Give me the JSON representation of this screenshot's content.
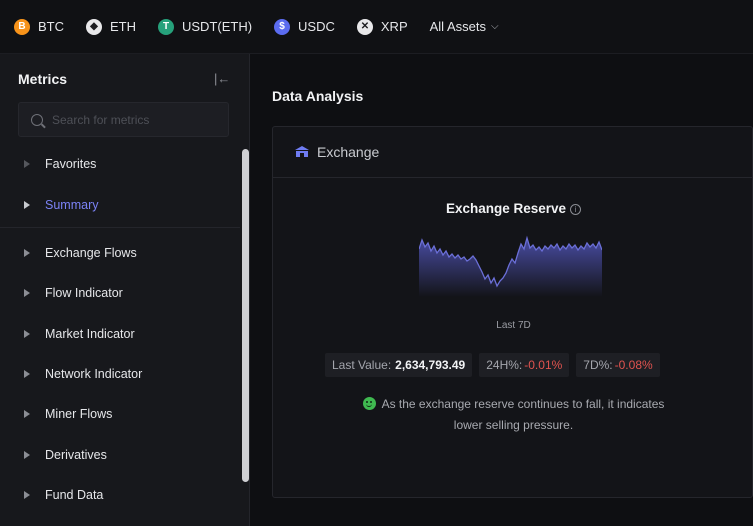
{
  "assets": [
    {
      "label": "BTC",
      "icon": "bitcoin-icon",
      "glyph": "B"
    },
    {
      "label": "ETH",
      "icon": "ethereum-icon",
      "glyph": "◆"
    },
    {
      "label": "USDT(ETH)",
      "icon": "tether-icon",
      "glyph": "T"
    },
    {
      "label": "USDC",
      "icon": "usdc-icon",
      "glyph": "$"
    },
    {
      "label": "XRP",
      "icon": "xrp-icon",
      "glyph": "✕"
    },
    {
      "label": "All Assets",
      "icon": "chevron-down-icon"
    }
  ],
  "sidebar": {
    "title": "Metrics",
    "search_placeholder": "Search for metrics",
    "items": [
      {
        "label": "Favorites"
      },
      {
        "label": "Summary",
        "active": true
      },
      {
        "label": "Exchange Flows"
      },
      {
        "label": "Flow Indicator"
      },
      {
        "label": "Market Indicator"
      },
      {
        "label": "Network Indicator"
      },
      {
        "label": "Miner Flows"
      },
      {
        "label": "Derivatives"
      },
      {
        "label": "Fund Data"
      }
    ]
  },
  "main": {
    "section_title": "Data Analysis",
    "card": {
      "title": "Exchange",
      "metric_title": "Exchange Reserve",
      "period": "Last 7D",
      "last_value_label": "Last Value:",
      "last_value": "2,634,793.49",
      "change_24h_label": "24H%:",
      "change_24h": "-0.01%",
      "change_7d_label": "7D%:",
      "change_7d": "-0.08%",
      "note_line1": "As the exchange reserve continues to fall, it indicates",
      "note_line2": "lower selling pressure."
    }
  },
  "colors": {
    "accent": "#7b82f5",
    "negative": "#e0534f",
    "positive": "#3fb950",
    "sparkline": "#6b6fd8"
  }
}
